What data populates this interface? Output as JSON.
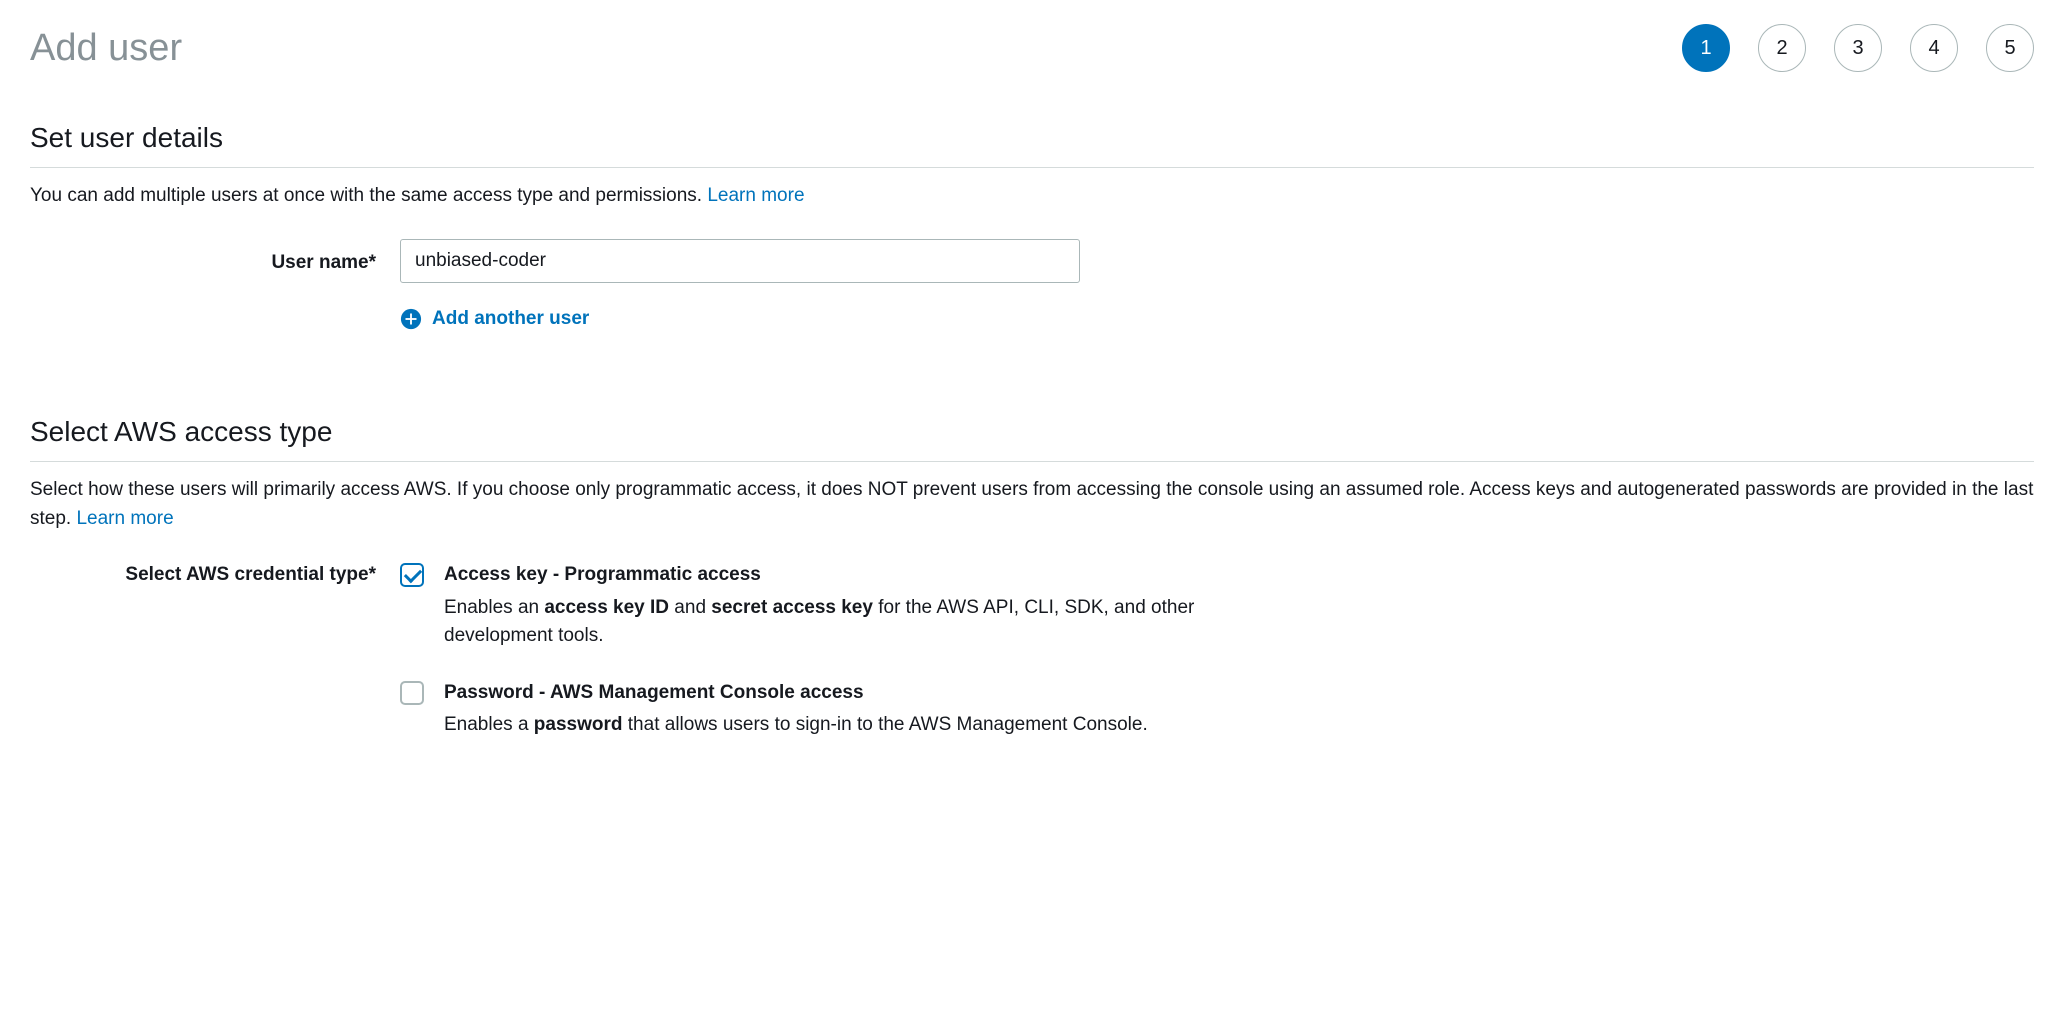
{
  "page_title": "Add user",
  "steps": [
    "1",
    "2",
    "3",
    "4",
    "5"
  ],
  "active_step_index": 0,
  "section_user_details": {
    "title": "Set user details",
    "description": "You can add multiple users at once with the same access type and permissions. ",
    "learn_more": "Learn more",
    "username_label": "User name*",
    "username_value": "unbiased-coder",
    "add_another_label": "Add another user"
  },
  "section_access_type": {
    "title": "Select AWS access type",
    "description": "Select how these users will primarily access AWS. If you choose only programmatic access, it does NOT prevent users from accessing the console using an assumed role. Access keys and autogenerated passwords are provided in the last step. ",
    "learn_more": "Learn more",
    "credential_label": "Select AWS credential type*",
    "options": [
      {
        "checked": true,
        "title": "Access key - Programmatic access",
        "desc_pre": "Enables an ",
        "desc_b1": "access key ID",
        "desc_mid": " and ",
        "desc_b2": "secret access key",
        "desc_post": " for the AWS API, CLI, SDK, and other development tools."
      },
      {
        "checked": false,
        "title": "Password - AWS Management Console access",
        "desc_pre": "Enables a ",
        "desc_b1": "password",
        "desc_mid": "",
        "desc_b2": "",
        "desc_post": " that allows users to sign-in to the AWS Management Console."
      }
    ]
  }
}
